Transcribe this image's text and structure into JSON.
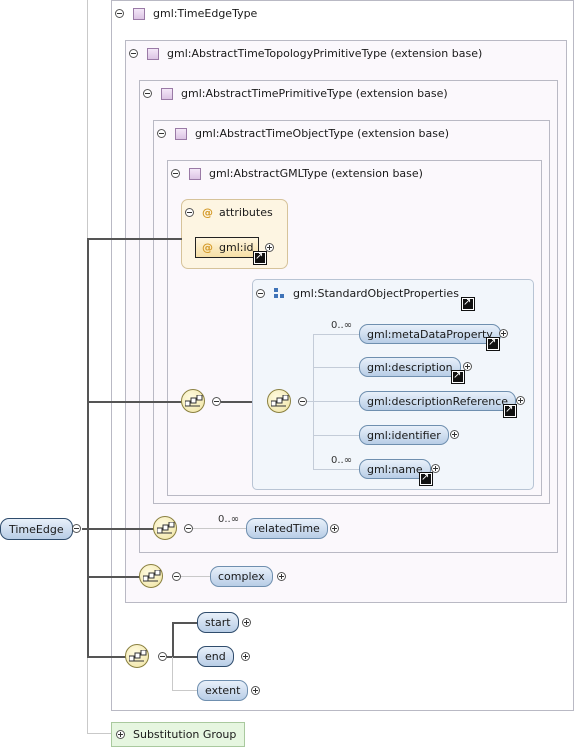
{
  "diagram": {
    "root": {
      "label": "TimeEdge"
    },
    "time_edge_type": {
      "title": "gml:TimeEdgeType"
    },
    "topology_primitive": {
      "title": "gml:AbstractTimeTopologyPrimitiveType (extension base)"
    },
    "time_primitive": {
      "title": "gml:AbstractTimePrimitiveType (extension base)"
    },
    "time_object": {
      "title": "gml:AbstractTimeObjectType (extension base)"
    },
    "gml_type": {
      "title": "gml:AbstractGMLType (extension base)"
    },
    "attributes": {
      "title": "attributes",
      "id_label": "gml:id"
    },
    "standard_props": {
      "title": "gml:StandardObjectProperties",
      "items": [
        {
          "label": "gml:metaDataProperty",
          "occurrence": "0..∞"
        },
        {
          "label": "gml:description",
          "occurrence": ""
        },
        {
          "label": "gml:descriptionReference",
          "occurrence": ""
        },
        {
          "label": "gml:identifier",
          "occurrence": ""
        },
        {
          "label": "gml:name",
          "occurrence": "0..∞"
        }
      ]
    },
    "related_time": {
      "label": "relatedTime",
      "occurrence": "0..∞"
    },
    "complex": {
      "label": "complex"
    },
    "start": {
      "label": "start"
    },
    "end": {
      "label": "end"
    },
    "extent": {
      "label": "extent"
    },
    "substitution": {
      "label": "Substitution Group"
    }
  },
  "colors": {
    "frame_border": "#b9b9c4",
    "frame_fill": "#fbf8fc",
    "node_fill": "#c8d9ee",
    "attr_fill": "#fdf5e2",
    "subst_fill": "#e6f6e0"
  }
}
